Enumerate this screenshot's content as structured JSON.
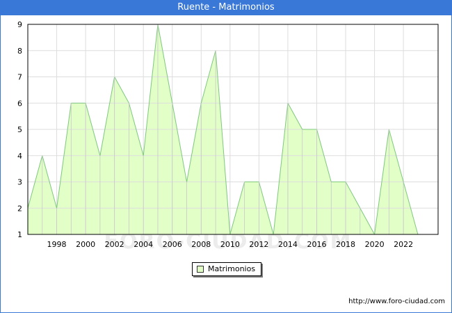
{
  "window": {
    "title": "Ruente - Matrimonios"
  },
  "watermark": "FORO-CIUDAD.COM",
  "source": "http://www.foro-ciudad.com",
  "colors": {
    "fill": "#e2ffc8",
    "line": "#7ec87e",
    "titlebar": "#3a78d8"
  },
  "chart_data": {
    "type": "area",
    "title": "Ruente - Matrimonios",
    "x": [
      1996,
      1997,
      1998,
      1999,
      2000,
      2001,
      2002,
      2003,
      2004,
      2005,
      2006,
      2007,
      2008,
      2009,
      2010,
      2011,
      2012,
      2013,
      2014,
      2015,
      2016,
      2017,
      2018,
      2019,
      2020,
      2021,
      2022,
      2023
    ],
    "series": [
      {
        "name": "Matrimonios",
        "values": [
          2,
          4,
          2,
          6,
          6,
          4,
          7,
          6,
          4,
          9,
          6,
          3,
          6,
          8,
          1,
          3,
          3,
          1,
          6,
          5,
          5,
          3,
          3,
          2,
          1,
          5,
          3,
          1
        ]
      }
    ],
    "x_ticks": [
      "1998",
      "2000",
      "2002",
      "2004",
      "2006",
      "2008",
      "2010",
      "2012",
      "2014",
      "2016",
      "2018",
      "2020",
      "2022"
    ],
    "y_ticks": [
      "1",
      "2",
      "3",
      "4",
      "5",
      "6",
      "7",
      "8",
      "9"
    ],
    "xlim": [
      1996,
      2024.4
    ],
    "ylim": [
      1,
      9
    ],
    "grid": true,
    "legend": "bottom-center"
  }
}
